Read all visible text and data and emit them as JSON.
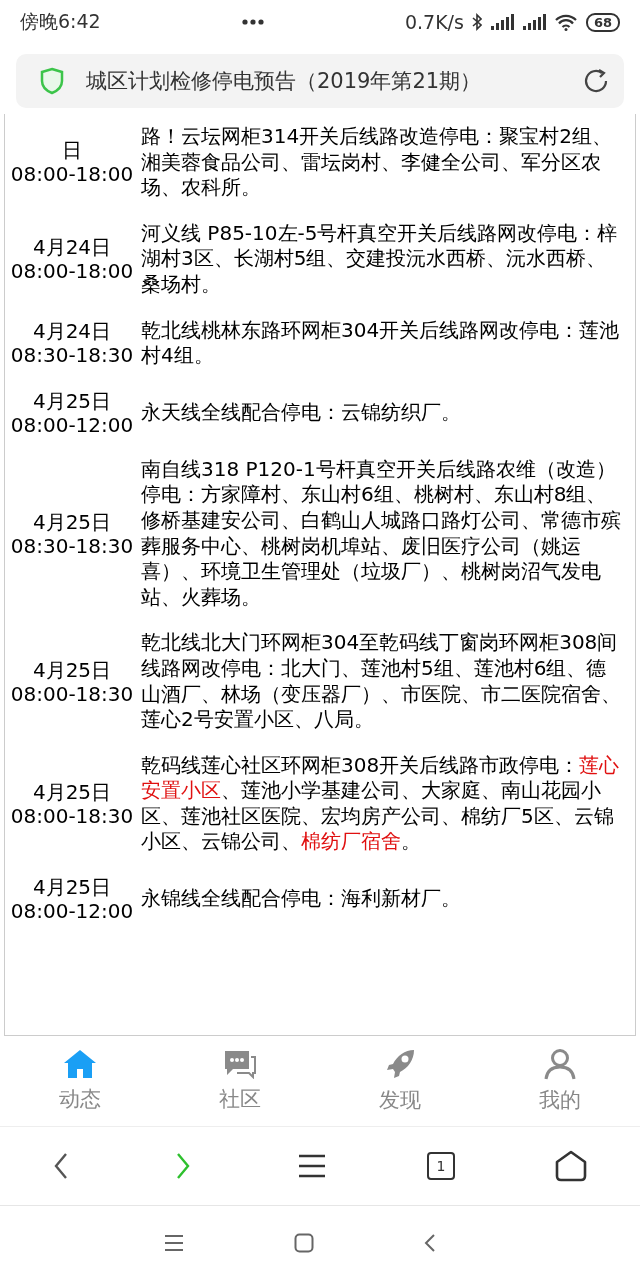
{
  "status_bar": {
    "time": "傍晚6:42",
    "speed": "0.7K/s",
    "battery": "68"
  },
  "address_bar": {
    "title": "城区计划检修停电预告（2019年第21期）"
  },
  "notices": [
    {
      "date": "日",
      "time": "08:00-18:00",
      "segments": [
        {
          "text": "路！云坛网柜314开关后线路改造停电：聚宝村2组、湘美蓉食品公司、雷坛岗村、李健全公司、军分区农场、农科所。",
          "highlight": false
        }
      ]
    },
    {
      "date": "4月24日",
      "time": "08:00-18:00",
      "segments": [
        {
          "text": "河义线 P85-10左-5号杆真空开关后线路网改停电：梓湖村3区、长湖村5组、交建投沅水西桥、沅水西桥、桑场村。",
          "highlight": false
        }
      ]
    },
    {
      "date": "4月24日",
      "time": "08:30-18:30",
      "segments": [
        {
          "text": "乾北线桃林东路环网柜304开关后线路网改停电：莲池村4组。",
          "highlight": false
        }
      ]
    },
    {
      "date": "4月25日",
      "time": "08:00-12:00",
      "segments": [
        {
          "text": "永天线全线配合停电：云锦纺织厂。",
          "highlight": false
        }
      ]
    },
    {
      "date": "4月25日",
      "time": "08:30-18:30",
      "segments": [
        {
          "text": "南自线318 P120-1号杆真空开关后线路农维（改造）停电：方家障村、东山村6组、桃树村、东山村8组、修桥基建安公司、白鹤山人城路口路灯公司、常德市殡葬服务中心、桃树岗机埠站、废旧医疗公司（姚运喜）、环境卫生管理处（垃圾厂）、桃树岗沼气发电站、火葬场。",
          "highlight": false
        }
      ]
    },
    {
      "date": "4月25日",
      "time": "08:00-18:30",
      "segments": [
        {
          "text": "乾北线北大门环网柜304至乾码线丁窗岗环网柜308间线路网改停电：北大门、莲池村5组、莲池村6组、德山酒厂、林场（变压器厂）、市医院、市二医院宿舍、莲心2号安置小区、八局。",
          "highlight": false
        }
      ]
    },
    {
      "date": "4月25日",
      "time": "08:00-18:30",
      "segments": [
        {
          "text": "乾码线莲心社区环网柜308开关后线路市政停电：",
          "highlight": false
        },
        {
          "text": "莲心安置小区",
          "highlight": true
        },
        {
          "text": "、莲池小学基建公司、大家庭、南山花园小区、莲池社区医院、宏均房产公司、棉纺厂5区、云锦小区、云锦公司、",
          "highlight": false
        },
        {
          "text": "棉纺厂宿舍",
          "highlight": true
        },
        {
          "text": "。",
          "highlight": false
        }
      ]
    },
    {
      "date": "4月25日",
      "time": "08:00-12:00",
      "segments": [
        {
          "text": "永锦线全线配合停电：海利新材厂。",
          "highlight": false
        }
      ]
    }
  ],
  "bottom_tabs": [
    {
      "label": "动态",
      "kind": "home",
      "selected": true
    },
    {
      "label": "社区",
      "kind": "chat",
      "selected": false
    },
    {
      "label": "发现",
      "kind": "rocket",
      "selected": false
    },
    {
      "label": "我的",
      "kind": "user",
      "selected": false
    }
  ],
  "browser_toolbar": {
    "back_enabled": false,
    "forward_enabled": true,
    "tab_count": "1"
  }
}
